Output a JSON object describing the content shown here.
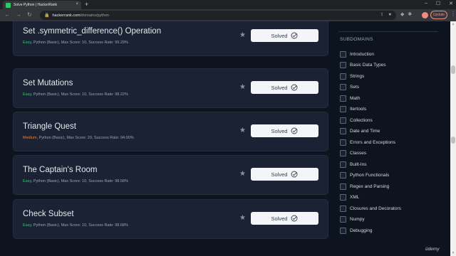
{
  "browser": {
    "tab_title": "Solve Python | HackerRank",
    "tab_close": "×",
    "new_tab": "+",
    "url_host": "hackerrank.com",
    "url_path": "/domains/python",
    "update_label": "Update",
    "icons": {
      "back": "←",
      "forward": "→",
      "reload": "↻",
      "lock": "🔒",
      "share": "⇪",
      "bookmark_star": "★",
      "menu": "⋮",
      "minimize": "–",
      "maximize": "☐",
      "close": "✕"
    }
  },
  "challenges": [
    {
      "title": "Set .symmetric_difference() Operation",
      "difficulty": "Easy",
      "meta": ", Python (Basic), Max Score: 10, Success Rate: 99.29%",
      "status": "Solved"
    },
    {
      "title": "Set Mutations",
      "difficulty": "Easy",
      "meta": ", Python (Basic), Max Score: 10, Success Rate: 98.22%",
      "status": "Solved"
    },
    {
      "title": "Triangle Quest",
      "difficulty": "Medium",
      "meta": ", Python (Basic), Max Score: 20, Success Rate: 94.00%",
      "status": "Solved"
    },
    {
      "title": "The Captain's Room",
      "difficulty": "Easy",
      "meta": ", Python (Basic), Max Score: 10, Success Rate: 98.58%",
      "status": "Solved"
    },
    {
      "title": "Check Subset",
      "difficulty": "Easy",
      "meta": ", Python (Basic), Max Score: 10, Success Rate: 98.68%",
      "status": "Solved"
    }
  ],
  "sidebar": {
    "title": "SUBDOMAINS",
    "items": [
      "Introduction",
      "Basic Data Types",
      "Strings",
      "Sets",
      "Math",
      "Itertools",
      "Collections",
      "Date and Time",
      "Errors and Exceptions",
      "Classes",
      "Built-Ins",
      "Python Functionals",
      "Regex and Parsing",
      "XML",
      "Closures and Decorators",
      "Numpy",
      "Debugging"
    ]
  },
  "watermark": "ûdemy",
  "colors": {
    "background": "#0e141e",
    "card": "#1a2233",
    "easy": "#2ec866",
    "medium": "#f0822b"
  }
}
